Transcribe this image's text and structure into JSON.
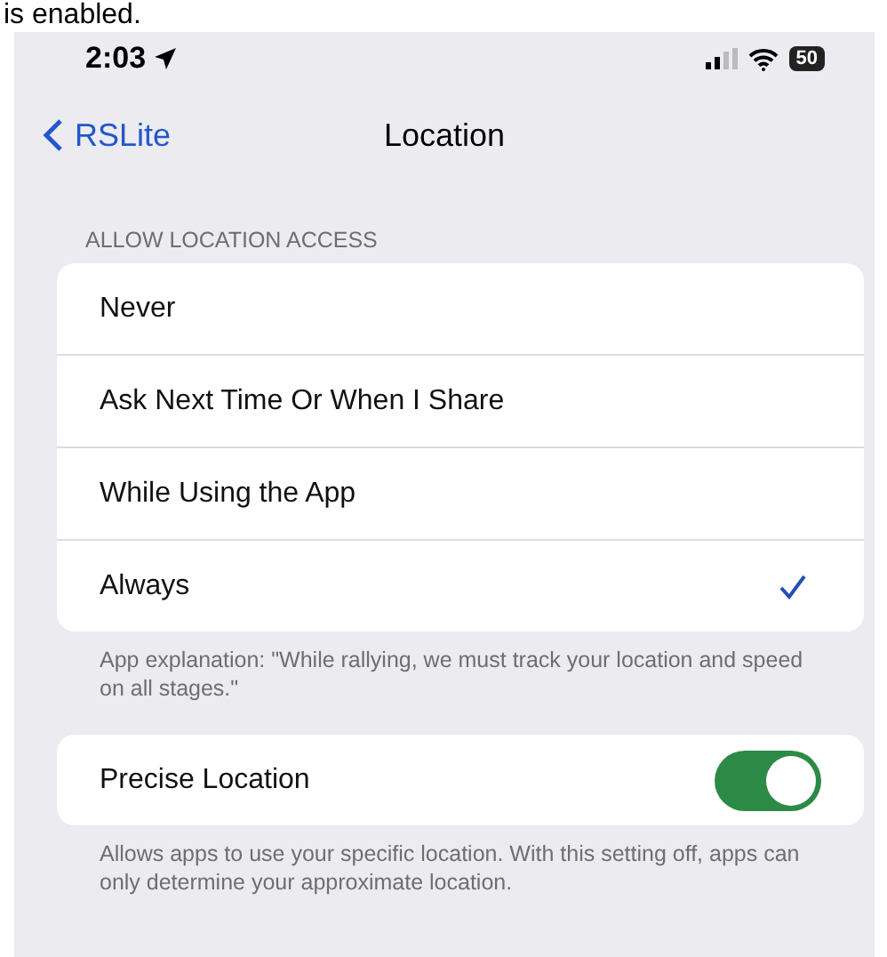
{
  "document_text": "is enabled.",
  "status_bar": {
    "time": "2:03",
    "battery": "50"
  },
  "nav": {
    "back": "RSLite",
    "title": "Location"
  },
  "section_header": "ALLOW LOCATION ACCESS",
  "options": [
    {
      "label": "Never",
      "selected": false
    },
    {
      "label": "Ask Next Time Or When I Share",
      "selected": false
    },
    {
      "label": "While Using the App",
      "selected": false
    },
    {
      "label": "Always",
      "selected": true
    }
  ],
  "options_footer": "App explanation: \"While rallying, we must track your location and speed on all stages.\"",
  "precise": {
    "label": "Precise Location",
    "on": true
  },
  "precise_footer": "Allows apps to use your specific location. With this setting off, apps can only determine your approximate location."
}
